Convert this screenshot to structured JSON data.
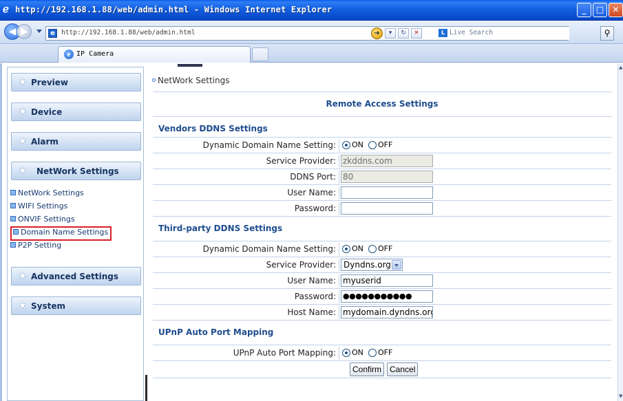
{
  "window": {
    "title": "http://192.168.1.88/web/admin.html - Windows Internet Explorer",
    "url": "http://192.168.1.88/web/admin.html",
    "search_placeholder": "Live Search",
    "tab_label": "IP Camera",
    "min_glyph": "_",
    "max_glyph": "□",
    "close_glyph": "✕",
    "back_glyph": "◀",
    "fwd_glyph": "▶"
  },
  "sidebar": {
    "menus": [
      {
        "label": "Preview",
        "icon": "star-icon"
      },
      {
        "label": "Device",
        "icon": "star-icon"
      },
      {
        "label": "Alarm",
        "icon": "star-icon"
      },
      {
        "label": "NetWork Settings",
        "icon": "star-icon"
      },
      {
        "label": "Advanced Settings",
        "icon": "star-icon"
      },
      {
        "label": "System",
        "icon": "star-icon"
      }
    ],
    "submenu": [
      "NetWork Settings",
      "WIFI Settings",
      "ONVIF Settings",
      "Domain Name Settings",
      "P2P Setting"
    ]
  },
  "main": {
    "breadcrumb": "NetWork Settings",
    "header": "Remote Access Settings",
    "vendors": {
      "title": "Vendors DDNS Settings",
      "ddns_label": "Dynamic Domain Name Setting:",
      "on": "ON",
      "off": "OFF",
      "provider_label": "Service Provider:",
      "provider_value": "zkddns.com",
      "port_label": "DDNS Port:",
      "port_value": "80",
      "user_label": "User Name:",
      "user_value": "",
      "pass_label": "Password:",
      "pass_value": ""
    },
    "third": {
      "title": "Third-party DDNS Settings",
      "ddns_label": "Dynamic Domain Name Setting:",
      "on": "ON",
      "off": "OFF",
      "provider_label": "Service Provider:",
      "provider_value": "Dyndns.org",
      "user_label": "User Name:",
      "user_value": "myuserid",
      "pass_label": "Password:",
      "pass_value": "●●●●●●●●●●●",
      "host_label": "Host Name:",
      "host_value": "mydomain.dyndns.org"
    },
    "upnp": {
      "title": "UPnP Auto Port Mapping",
      "label": "UPnP Auto Port Mapping:",
      "on": "ON",
      "off": "OFF"
    },
    "buttons": {
      "confirm": "Confirm",
      "cancel": "Cancel"
    }
  },
  "colors": {
    "accent": "#1f4d8f",
    "highlight_border": "#d8202a"
  }
}
